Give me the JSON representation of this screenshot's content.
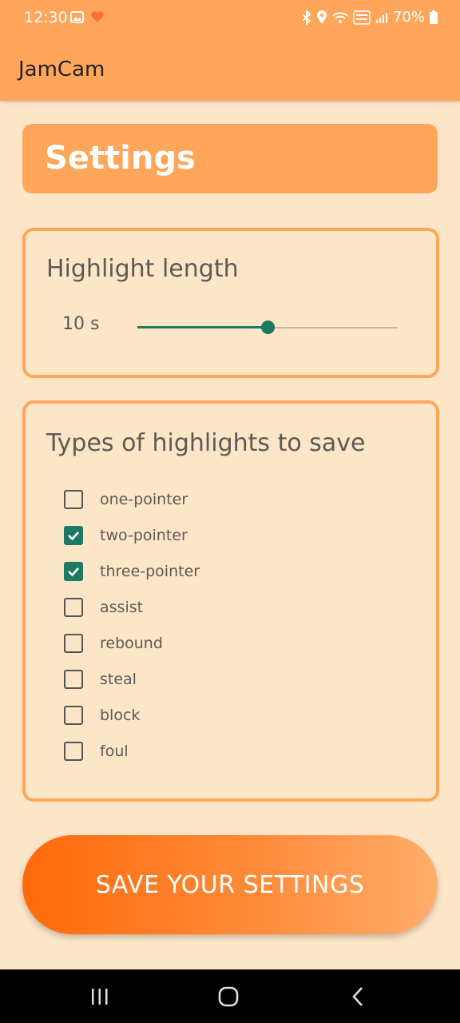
{
  "status_bar": {
    "time": "12:30",
    "battery": "70%",
    "icons": [
      "gallery-icon",
      "heart-icon",
      "bluetooth-icon",
      "location-icon",
      "wifi-icon",
      "volte-icon",
      "signal-icon",
      "battery-icon"
    ]
  },
  "app_bar": {
    "title": "JamCam"
  },
  "header": {
    "title": "Settings"
  },
  "highlight_length": {
    "title": "Highlight length",
    "value_label": "10 s",
    "slider_fraction": 0.5
  },
  "highlight_types": {
    "title": "Types of highlights to save",
    "items": [
      {
        "label": "one-pointer",
        "checked": false
      },
      {
        "label": "two-pointer",
        "checked": true
      },
      {
        "label": "three-pointer",
        "checked": true
      },
      {
        "label": "assist",
        "checked": false
      },
      {
        "label": "rebound",
        "checked": false
      },
      {
        "label": "steal",
        "checked": false
      },
      {
        "label": "block",
        "checked": false
      },
      {
        "label": "foul",
        "checked": false
      }
    ]
  },
  "save_button": {
    "label": "SAVE YOUR SETTINGS"
  },
  "colors": {
    "accent": "#ffa65a",
    "background": "#fde5c8",
    "control": "#1d7a62",
    "button_start": "#ff6a0a",
    "button_end": "#ffad6b"
  },
  "nav_bar": {
    "icons": [
      "recents-icon",
      "home-icon",
      "back-icon"
    ]
  }
}
